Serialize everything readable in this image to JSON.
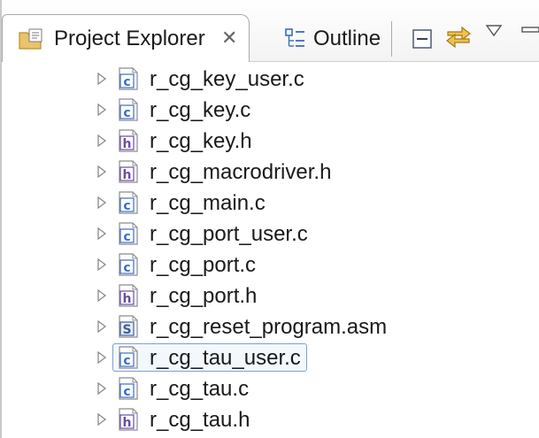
{
  "view": {
    "active_tab": {
      "label": "Project Explorer",
      "close_glyph": "✕",
      "icon": "folder-icon"
    },
    "other_tab": {
      "label": "Outline",
      "icon": "outline-icon"
    },
    "toolbar": {
      "collapse_icon": "collapse-all-icon",
      "link_icon": "link-with-editor-icon",
      "menu_icon": "view-menu-icon",
      "minimize_icon": "minimize-icon"
    }
  },
  "colors": {
    "c_file": "#3a6ec8",
    "h_file": "#6b4aa8",
    "asm_file": "#3d5e99",
    "selection_border": "#7da2ce"
  },
  "files": [
    {
      "name": "r_cg_key_user.c",
      "type": "c",
      "badge": "c",
      "selected": false
    },
    {
      "name": "r_cg_key.c",
      "type": "c",
      "badge": "c",
      "selected": false
    },
    {
      "name": "r_cg_key.h",
      "type": "h",
      "badge": "h",
      "selected": false
    },
    {
      "name": "r_cg_macrodriver.h",
      "type": "h",
      "badge": "h",
      "selected": false
    },
    {
      "name": "r_cg_main.c",
      "type": "c",
      "badge": "c",
      "selected": false
    },
    {
      "name": "r_cg_port_user.c",
      "type": "c",
      "badge": "c",
      "selected": false
    },
    {
      "name": "r_cg_port.c",
      "type": "c",
      "badge": "c",
      "selected": false
    },
    {
      "name": "r_cg_port.h",
      "type": "h",
      "badge": "h",
      "selected": false
    },
    {
      "name": "r_cg_reset_program.asm",
      "type": "asm",
      "badge": "S",
      "selected": false
    },
    {
      "name": "r_cg_tau_user.c",
      "type": "c",
      "badge": "c",
      "selected": true
    },
    {
      "name": "r_cg_tau.c",
      "type": "c",
      "badge": "c",
      "selected": false
    },
    {
      "name": "r_cg_tau.h",
      "type": "h",
      "badge": "h",
      "selected": false
    }
  ]
}
